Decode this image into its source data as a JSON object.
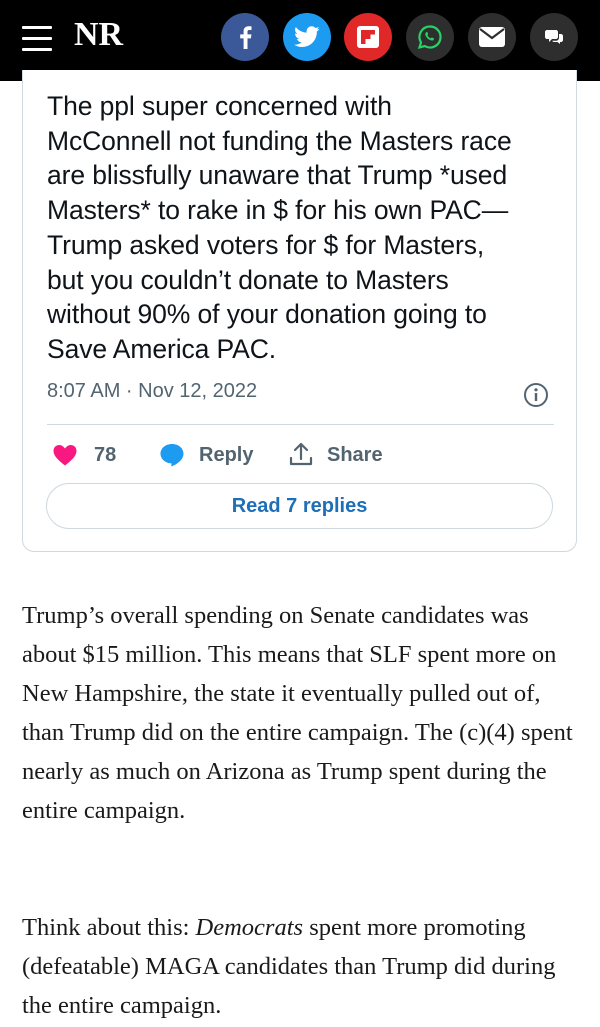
{
  "header": {
    "logo": "NR",
    "share_buttons": [
      {
        "icon": "facebook-icon",
        "color": "#3b5998"
      },
      {
        "icon": "twitter-icon",
        "color": "#1d9bf0"
      },
      {
        "icon": "flipboard-icon",
        "color": "#e12828"
      },
      {
        "icon": "whatsapp-icon",
        "color": "#2e2e2e"
      },
      {
        "icon": "email-icon",
        "color": "#2e2e2e"
      },
      {
        "icon": "comments-icon",
        "color": "#2e2e2e"
      }
    ]
  },
  "tweet": {
    "text": "The ppl super concerned with\nMcConnell not funding the Masters race\nare blissfully unaware that Trump *used\nMasters* to rake in $ for his own PAC—\nTrump asked voters for $ for Masters,\nbut you couldn’t donate to Masters\nwithout 90% of your donation going to\nSave America PAC.",
    "timestamp": "8:07 AM · Nov 12, 2022",
    "likes": "78",
    "reply_label": "Reply",
    "share_label": "Share",
    "read_replies_label": "Read 7 replies",
    "like_color": "#f91880",
    "reply_color": "#1d9bf0"
  },
  "article": {
    "paragraph1": "Trump’s overall spending on Senate candidates was about $15 million. This means that SLF spent more on New Hampshire, the state it eventually pulled out of, than Trump did on the entire campaign. The (c)(4) spent nearly as much on Arizona as Trump spent during the entire campaign.",
    "paragraph2_prefix": "Think about this: ",
    "paragraph2_emphasis": "Democrats",
    "paragraph2_suffix": " spent more promoting (defeatable) MAGA candidates than Trump did during the entire campaign."
  }
}
